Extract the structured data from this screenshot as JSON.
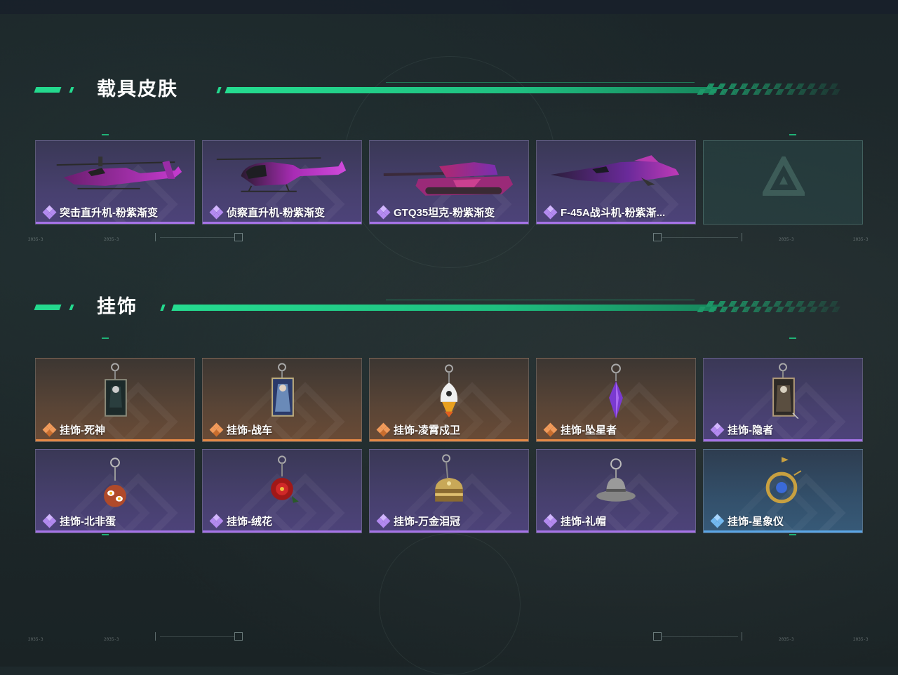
{
  "sections": [
    {
      "title": "载具皮肤"
    },
    {
      "title": "挂饰"
    }
  ],
  "vehicle_items": [
    {
      "label": "突击直升机-粉紫渐变",
      "rarity": "purple",
      "icon": "attack-helicopter-icon"
    },
    {
      "label": "侦察直升机-粉紫渐变",
      "rarity": "purple",
      "icon": "scout-helicopter-icon"
    },
    {
      "label": "GTQ35坦克-粉紫渐变",
      "rarity": "purple",
      "icon": "tank-icon"
    },
    {
      "label": "F-45A战斗机-粉紫渐...",
      "rarity": "purple",
      "icon": "fighter-jet-icon"
    }
  ],
  "charm_items_row1": [
    {
      "label": "挂饰-死神",
      "rarity": "orange",
      "icon": "reaper-card-charm-icon"
    },
    {
      "label": "挂饰-战车",
      "rarity": "orange",
      "icon": "chariot-card-charm-icon"
    },
    {
      "label": "挂饰-凌霄戍卫",
      "rarity": "orange",
      "icon": "rocket-guard-charm-icon"
    },
    {
      "label": "挂饰-坠星者",
      "rarity": "orange",
      "icon": "purple-crystal-charm-icon"
    },
    {
      "label": "挂饰-隐者",
      "rarity": "purple",
      "icon": "hermit-card-charm-icon"
    }
  ],
  "charm_items_row2": [
    {
      "label": "挂饰-北非蛋",
      "rarity": "purple",
      "icon": "shakshuka-charm-icon"
    },
    {
      "label": "挂饰-绒花",
      "rarity": "purple",
      "icon": "red-flower-charm-icon"
    },
    {
      "label": "挂饰-万金泪冠",
      "rarity": "purple",
      "icon": "golden-crown-charm-icon"
    },
    {
      "label": "挂饰-礼帽",
      "rarity": "purple",
      "icon": "fedora-hat-charm-icon"
    },
    {
      "label": "挂饰-星象仪",
      "rarity": "blue",
      "icon": "astrolabe-charm-icon"
    }
  ],
  "frame_labels": [
    "2035-3",
    "2035-3",
    "2035-3",
    "2035-3"
  ],
  "colors": {
    "accent_green": "#24d98e",
    "rarity_purple": "#a673e8",
    "rarity_orange": "#e58945",
    "rarity_blue": "#5aa6e6"
  }
}
